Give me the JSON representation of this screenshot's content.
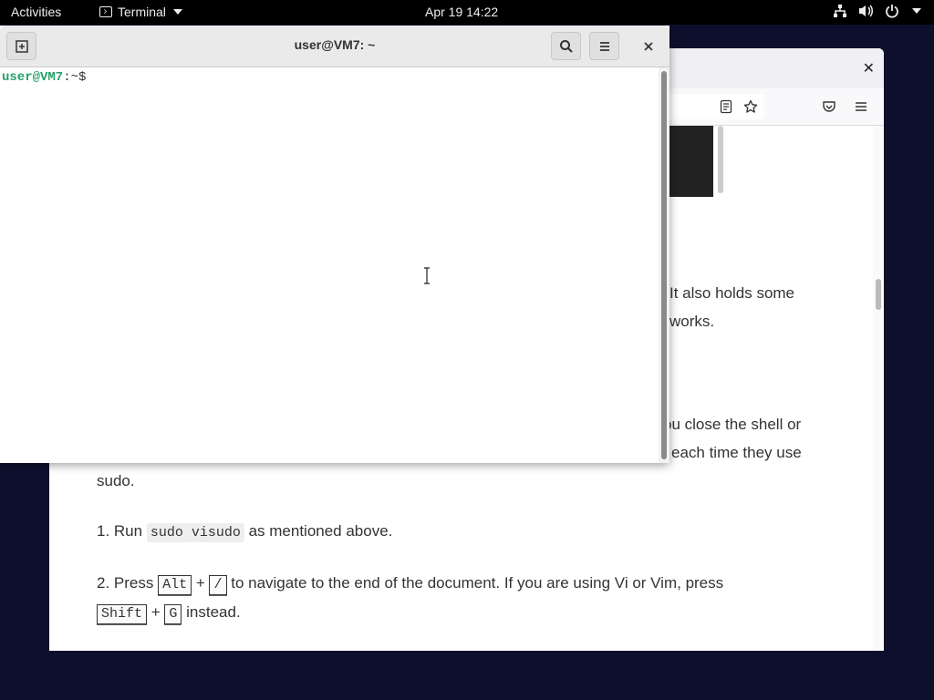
{
  "topbar": {
    "activities": "Activities",
    "app_name": "Terminal",
    "clock": "Apr 19  14:22"
  },
  "browser": {
    "paragraphs": {
      "p1a": "It also holds some",
      "p1b": "works.",
      "p2a": "ou close the shell or",
      "p2b": "each time they use",
      "p2c": "sudo."
    },
    "step1": {
      "prefix": "1. Run ",
      "code": "sudo visudo",
      "suffix": " as mentioned above."
    },
    "step2": {
      "prefix": "2. Press ",
      "key1": "Alt",
      "plus1": " + ",
      "key2": "/",
      "middle": " to navigate to the end of the document. If you are using Vi or Vim, press",
      "key3": "Shift",
      "plus2": " + ",
      "key4": "G",
      "suffix": " instead."
    }
  },
  "terminal": {
    "title": "user@VM7: ~",
    "prompt_user": "user@VM7",
    "prompt_path": ":~$"
  }
}
